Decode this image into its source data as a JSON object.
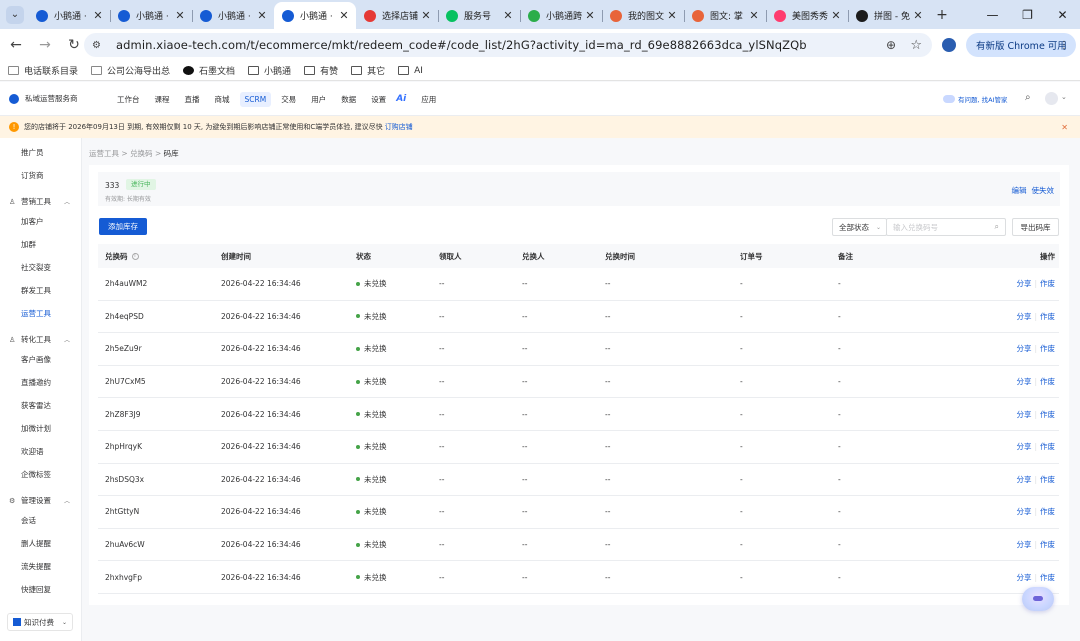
{
  "browser": {
    "tabs": [
      {
        "title": "小鹅通 ·",
        "icon_color": "#155bd4",
        "icon": "xiaoe-icon",
        "active": false
      },
      {
        "title": "小鹅通 ·",
        "icon_color": "#155bd4",
        "icon": "xiaoe-icon",
        "active": false
      },
      {
        "title": "小鹅通 ·",
        "icon_color": "#155bd4",
        "icon": "xiaoe-icon",
        "active": false
      },
      {
        "title": "小鹅通 ·",
        "icon_color": "#155bd4",
        "icon": "xiaoe-icon",
        "active": true
      },
      {
        "title": "选择店铺",
        "icon_color": "#e53935",
        "icon": "store-icon",
        "active": false
      },
      {
        "title": "服务号",
        "icon_color": "#07c160",
        "icon": "wechat-service-icon",
        "active": false
      },
      {
        "title": "小鹅通跨",
        "icon_color": "#2bad4a",
        "icon": "xiaoe-green-icon",
        "active": false
      },
      {
        "title": "我的图文",
        "icon_color": "#e8643a",
        "icon": "x-logo-icon",
        "active": false
      },
      {
        "title": "图文: 掌",
        "icon_color": "#e8643a",
        "icon": "x-logo-icon",
        "active": false
      },
      {
        "title": "美图秀秀",
        "icon_color": "#ff3c6f",
        "icon": "meitu-icon",
        "active": false
      },
      {
        "title": "拼图 - 免",
        "icon_color": "#1c1c1c",
        "icon": "collage-icon",
        "active": false
      }
    ],
    "url": "admin.xiaoe-tech.com/t/ecommerce/mkt/redeem_code#/code_list/2hG?activity_id=ma_rd_69e8882663dca_ylSNqZQb",
    "update_label": "有新版 Chrome 可用",
    "bookmarks": [
      {
        "label": "电话联系目录",
        "icon": "page-icon"
      },
      {
        "label": "公司公海导出总",
        "icon": "page-icon"
      },
      {
        "label": "石墨文档",
        "icon": "shimo-icon"
      },
      {
        "label": "小鹅通",
        "icon": "folder-icon"
      },
      {
        "label": "有赞",
        "icon": "folder-icon"
      },
      {
        "label": "其它",
        "icon": "folder-icon"
      },
      {
        "label": "AI",
        "icon": "folder-icon"
      }
    ]
  },
  "app": {
    "brand": "私域运营服务商",
    "nav": [
      {
        "label": "工作台",
        "active": false
      },
      {
        "label": "课程",
        "active": false
      },
      {
        "label": "直播",
        "active": false
      },
      {
        "label": "商城",
        "active": false
      },
      {
        "label": "SCRM",
        "active": true
      },
      {
        "label": "交易",
        "active": false
      },
      {
        "label": "用户",
        "active": false
      },
      {
        "label": "数据",
        "active": false
      },
      {
        "label": "设置",
        "active": false
      }
    ],
    "nav_ai": "Ai",
    "nav_apps": "应用",
    "assistant_label": "有问题, 找AI管家",
    "accent_color": "#155bd4"
  },
  "notice": {
    "text": "您的店铺将于 2026年09月13日 到期, 有效期仅剩 10 天, 为避免到期后影响店铺正常使用和C端学员体验, 建议尽快",
    "link": "订购店铺"
  },
  "sidebar": {
    "top_items": [
      "推广员",
      "订货商"
    ],
    "groups": [
      {
        "label": "营销工具",
        "items": [
          "加客户",
          "加群",
          "社交裂变",
          "群发工具",
          "运营工具"
        ],
        "active": "运营工具"
      },
      {
        "label": "转化工具",
        "items": [
          "客户画像",
          "直播邀约",
          "获客雷达",
          "加微计划",
          "欢迎语",
          "企微标签"
        ]
      },
      {
        "label": "管理设置",
        "items": [
          "会话",
          "删人提醒",
          "流失提醒",
          "快捷回复"
        ]
      }
    ],
    "footer_label": "知识付费"
  },
  "breadcrumb": [
    "运营工具",
    "兑换码",
    "码库"
  ],
  "code_info": {
    "name": "333",
    "status": "进行中",
    "validity": "有效期: 长期有效",
    "edit": "编辑",
    "invalidate": "使失效"
  },
  "toolbar": {
    "add_label": "添加库存",
    "status_filter": "全部状态",
    "search_placeholder": "输入兑换码号",
    "export_label": "导出码库"
  },
  "table": {
    "headers": [
      "兑换码",
      "创建时间",
      "状态",
      "领取人",
      "兑换人",
      "兑换时间",
      "订单号",
      "备注",
      "操作"
    ],
    "rows": [
      {
        "code": "2h4auWM2",
        "created": "2026-04-22 16:34:46",
        "status": "未兑换",
        "receiver": "--",
        "redeemer": "--",
        "redeem_time": "--",
        "order": "-",
        "note": "-"
      },
      {
        "code": "2h4eqPSD",
        "created": "2026-04-22 16:34:46",
        "status": "未兑换",
        "receiver": "--",
        "redeemer": "--",
        "redeem_time": "--",
        "order": "-",
        "note": "-"
      },
      {
        "code": "2h5eZu9r",
        "created": "2026-04-22 16:34:46",
        "status": "未兑换",
        "receiver": "--",
        "redeemer": "--",
        "redeem_time": "--",
        "order": "-",
        "note": "-"
      },
      {
        "code": "2hU7CxM5",
        "created": "2026-04-22 16:34:46",
        "status": "未兑换",
        "receiver": "--",
        "redeemer": "--",
        "redeem_time": "--",
        "order": "-",
        "note": "-"
      },
      {
        "code": "2hZ8F3J9",
        "created": "2026-04-22 16:34:46",
        "status": "未兑换",
        "receiver": "--",
        "redeemer": "--",
        "redeem_time": "--",
        "order": "-",
        "note": "-"
      },
      {
        "code": "2hpHrqyK",
        "created": "2026-04-22 16:34:46",
        "status": "未兑换",
        "receiver": "--",
        "redeemer": "--",
        "redeem_time": "--",
        "order": "-",
        "note": "-"
      },
      {
        "code": "2hsDSQ3x",
        "created": "2026-04-22 16:34:46",
        "status": "未兑换",
        "receiver": "--",
        "redeemer": "--",
        "redeem_time": "--",
        "order": "-",
        "note": "-"
      },
      {
        "code": "2htGttyN",
        "created": "2026-04-22 16:34:46",
        "status": "未兑换",
        "receiver": "--",
        "redeemer": "--",
        "redeem_time": "--",
        "order": "-",
        "note": "-"
      },
      {
        "code": "2huAv6cW",
        "created": "2026-04-22 16:34:46",
        "status": "未兑换",
        "receiver": "--",
        "redeemer": "--",
        "redeem_time": "--",
        "order": "-",
        "note": "-"
      },
      {
        "code": "2hxhvgFp",
        "created": "2026-04-22 16:34:46",
        "status": "未兑换",
        "receiver": "--",
        "redeemer": "--",
        "redeem_time": "--",
        "order": "-",
        "note": "-"
      }
    ],
    "row_actions": [
      "分享",
      "作废"
    ]
  }
}
